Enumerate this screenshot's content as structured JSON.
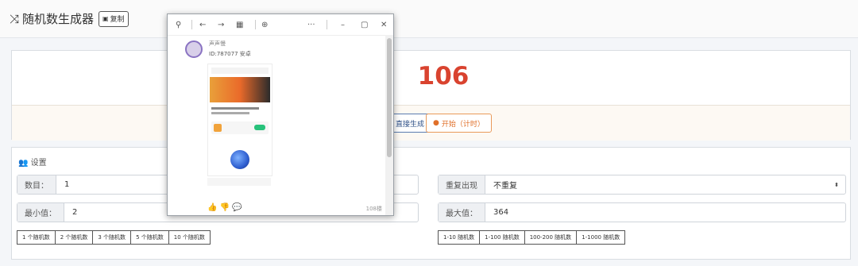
{
  "header": {
    "title": "随机数生成器",
    "copy_label": "复制"
  },
  "result": {
    "value": "106",
    "direct_label": "直接生成",
    "start_label": "开始（计时）"
  },
  "settings": {
    "title": "设置",
    "count": {
      "label": "数目：",
      "value": "1"
    },
    "repeat": {
      "label": "重复出现",
      "value": "不重复"
    },
    "min": {
      "label": "最小值：",
      "value": "2"
    },
    "max": {
      "label": "最大值：",
      "value": "364"
    },
    "count_presets": [
      "1 个随机数",
      "2 个随机数",
      "3 个随机数",
      "5 个随机数",
      "10 个随机数"
    ],
    "range_presets": [
      "1-10 随机数",
      "1-100 随机数",
      "100-200 随机数",
      "1-1000 随机数"
    ]
  },
  "popup": {
    "username": "声声慢",
    "user_id": "ID:787077 安卓",
    "reply_count": "108楼"
  }
}
